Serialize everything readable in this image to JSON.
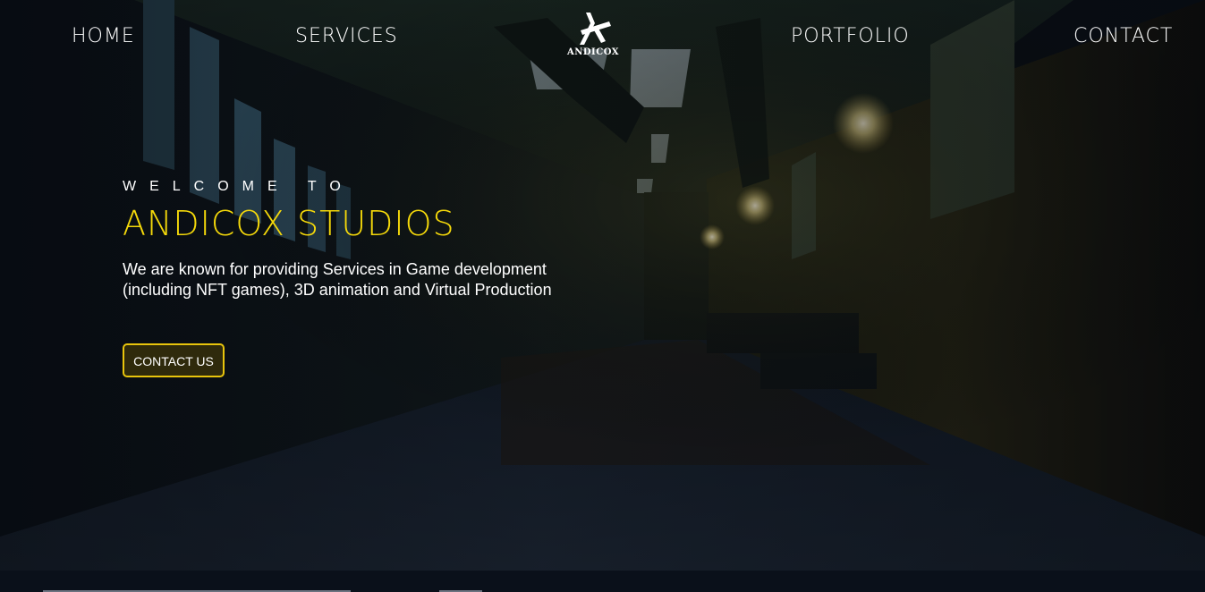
{
  "nav": {
    "home_label": "HOME",
    "services_label": "SERVICES",
    "portfolio_label": "PORTFOLIO",
    "contact_label": "CONTACT",
    "logo_text": "ANDICOX",
    "logo_icon": "andicox-logo-icon"
  },
  "hero": {
    "welcome": "WELCOME TO",
    "title": "ANDICOX STUDIOS",
    "description": "We are known for providing Services in Game development (including NFT games), 3D animation and Virtual Production",
    "cta_label": "CONTACT US"
  },
  "colors": {
    "accent": "#f5d90a",
    "button_border": "#e8c40c",
    "text": "#ffffff",
    "background": "#0b1018"
  }
}
